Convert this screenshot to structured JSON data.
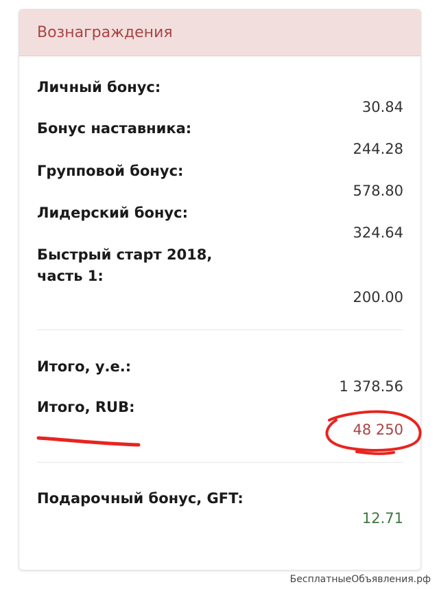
{
  "panel": {
    "title": "Вознаграждения"
  },
  "bonuses": [
    {
      "label": "Личный бонус:",
      "value": "30.84"
    },
    {
      "label": "Бонус наставника:",
      "value": "244.28"
    },
    {
      "label": "Групповой бонус:",
      "value": "578.80"
    },
    {
      "label": "Лидерский бонус:",
      "value": "324.64"
    },
    {
      "label": "Быстрый старт 2018, часть 1:",
      "value": "200.00"
    }
  ],
  "totals": {
    "total_ue_label": "Итого, у.е.:",
    "total_ue_value": "1 378.56",
    "total_rub_label": "Итого, RUB:",
    "total_rub_value": "48 250"
  },
  "gift": {
    "label": "Подарочный бонус, GFT:",
    "value": "12.71"
  },
  "watermark": "БесплатныеОбъявления.рф",
  "colors": {
    "header_bg": "#f3dede",
    "header_text": "#a94442",
    "rub_value": "#a94442",
    "gift_value": "#3c763d",
    "annotation": "#e8231f"
  }
}
